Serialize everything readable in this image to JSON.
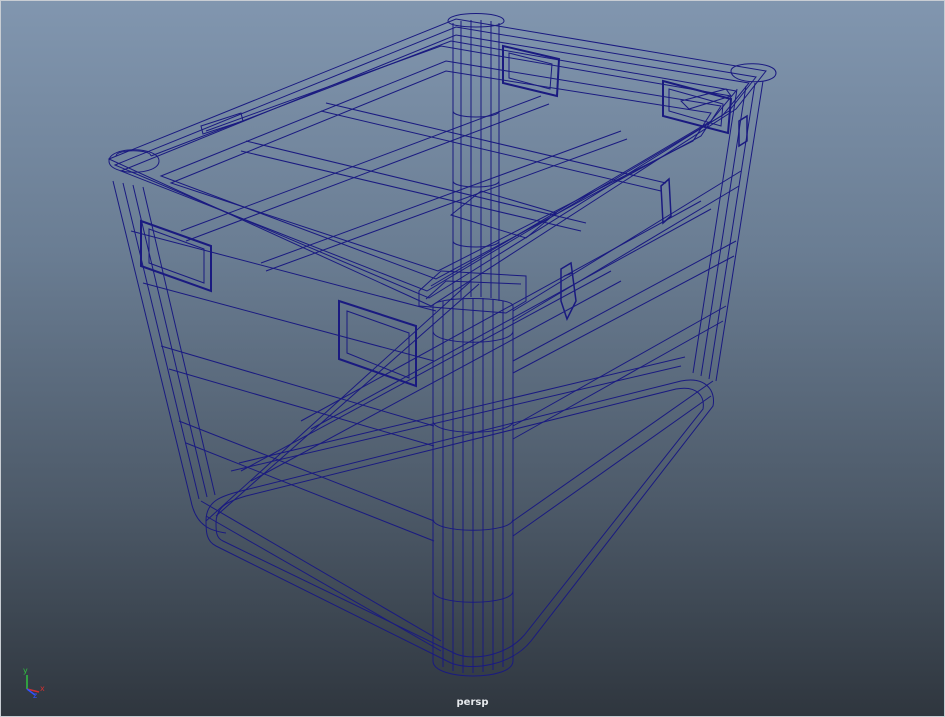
{
  "viewport": {
    "camera_label": "persp",
    "background_top": "#8196af",
    "background_bottom": "#2f363e",
    "wireframe_color": "#1a1a80"
  },
  "axis_gizmo": {
    "x_label": "x",
    "y_label": "y",
    "z_label": "z",
    "x_color": "#d03030",
    "y_color": "#30c040",
    "z_color": "#3050ff"
  }
}
